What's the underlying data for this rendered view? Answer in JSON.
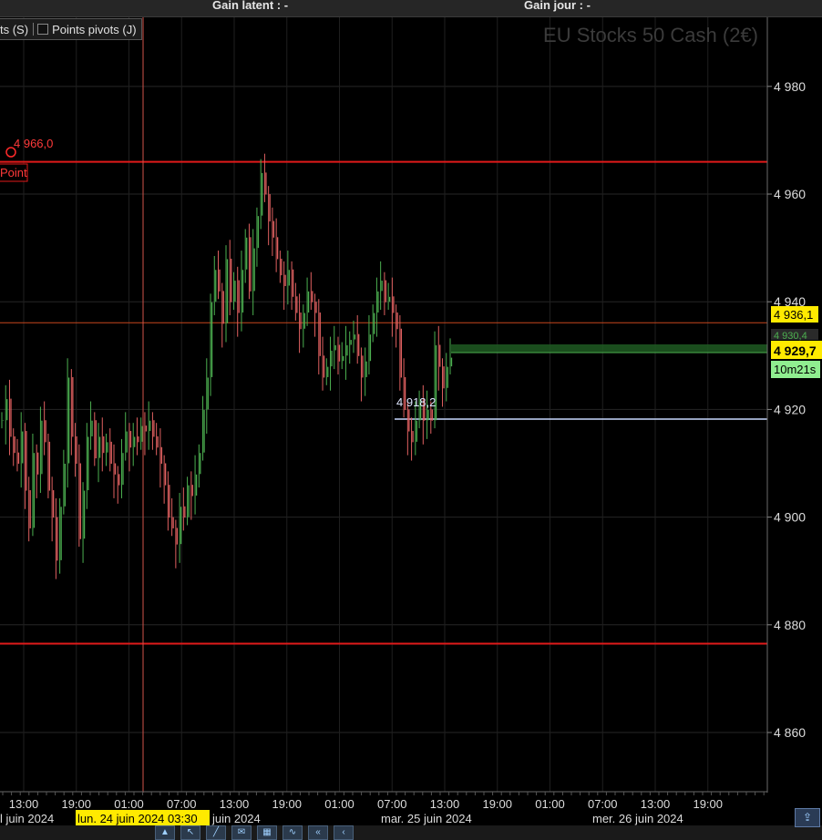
{
  "header": {
    "unrealized_gain": "Gain latent : -",
    "daily_gain": "Gain jour : -"
  },
  "toggles": {
    "prev_label": "ts (S)",
    "pivot_label": "Points pivots (J)"
  },
  "instrument_title": "EU Stocks 50 Cash (2€)",
  "crosshair_time_label": "lun. 24 juin 2024 03:30",
  "countdown": "10m21s",
  "price_tags": {
    "alert_price": "4 936,1",
    "hidden_price": "4 930,4",
    "current_price": "4 929,7"
  },
  "annotations": {
    "pivot_value": "4 966,0",
    "pivot_label": "Point",
    "low_value": "4 918,2"
  },
  "colors": {
    "background": "#000000",
    "up_candle": "#4caf50",
    "down_candle": "#e06060",
    "level_line": "#e01a1a",
    "low_line": "#c8d8ff",
    "price_tag": "#ffea00",
    "countdown_bg": "#90ee90"
  },
  "chart_data": {
    "type": "line",
    "title": "EU Stocks 50 Cash (2€)",
    "y_axis": {
      "ticks": [
        "4 980",
        "4 960",
        "4 940",
        "4 920",
        "4 900",
        "4 880",
        "4 860"
      ],
      "tick_values": [
        4980,
        4960,
        4940,
        4920,
        4900,
        4880,
        4860
      ],
      "range": [
        4849,
        4993
      ]
    },
    "x_axis": {
      "time_ticks": [
        "13:00",
        "19:00",
        "01:00",
        "07:00",
        "13:00",
        "19:00",
        "01:00",
        "07:00",
        "13:00",
        "19:00",
        "01:00",
        "07:00",
        "13:00",
        "19:00"
      ],
      "day_labels": [
        "l juin 2024",
        "juin 2024",
        "mar. 25 juin 2024",
        "mer. 26 juin 2024"
      ]
    },
    "horizontal_levels": [
      {
        "name": "Point",
        "value": 4966.0
      },
      {
        "name": "support",
        "value": 4876.5
      },
      {
        "name": "alert",
        "value": 4936.1
      },
      {
        "name": "low",
        "value": 4918.2
      }
    ],
    "last_price": 4929.7,
    "series": [
      {
        "values": [
          4918,
          4922,
          4915,
          4912,
          4910,
          4916,
          4905,
          4898,
          4912,
          4908,
          4918,
          4914,
          4905,
          4900,
          4892,
          4902,
          4910,
          4926,
          4915,
          4910,
          4896,
          4905,
          4915,
          4918,
          4911,
          4915,
          4912,
          4914,
          4910,
          4908,
          4906,
          4912,
          4916,
          4913,
          4915,
          4914,
          4917,
          4916,
          4918,
          4915,
          4913,
          4910,
          4906,
          4900,
          4898,
          4895,
          4902,
          4900,
          4906,
          4904,
          4908,
          4912,
          4920,
          4926,
          4940,
          4946,
          4942,
          4936,
          4948,
          4940,
          4944,
          4938,
          4946,
          4952,
          4942,
          4950,
          4956,
          4964,
          4960,
          4955,
          4952,
          4948,
          4945,
          4943,
          4946,
          4941,
          4938,
          4935,
          4938,
          4942,
          4940,
          4938,
          4930,
          4926,
          4928,
          4931,
          4932,
          4929,
          4930,
          4932,
          4933,
          4934,
          4930,
          4926,
          4929,
          4934,
          4938,
          4942,
          4944,
          4940,
          4941,
          4938,
          4935,
          4926,
          4920,
          4916,
          4914,
          4918,
          4922,
          4918,
          4920,
          4918,
          4932,
          4928,
          4924,
          4928,
          4929.7
        ]
      }
    ]
  }
}
